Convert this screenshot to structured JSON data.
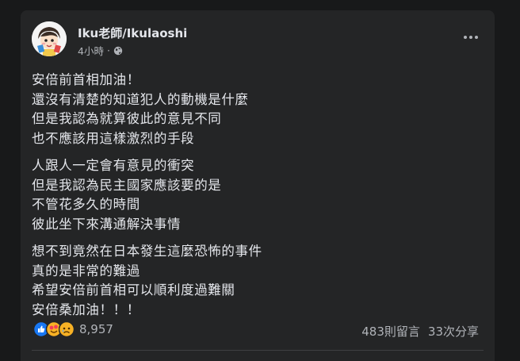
{
  "post": {
    "author": "Iku老師/Ikulaoshi",
    "time": "4小時",
    "separator": "·",
    "paragraphs": [
      [
        "安倍前首相加油！",
        "還沒有清楚的知道犯人的動機是什麼",
        "但是我認為就算彼此的意見不同",
        "也不應該用這樣激烈的手段"
      ],
      [
        "人跟人一定會有意見的衝突",
        "但是我認為民主國家應該要的是",
        "不管花多久的時間",
        "彼此坐下來溝通解決事情"
      ],
      [
        "想不到竟然在日本發生這麼恐怖的事件",
        "真的是非常的難過",
        "希望安倍前首相可以順利度過難關",
        "安倍桑加油！！！"
      ]
    ],
    "reaction_count": "8,957",
    "comments": "483則留言",
    "shares": "33次分享",
    "reaction_types": [
      "like",
      "love",
      "sad"
    ],
    "colors": {
      "like": "#1877f2",
      "love": "#f33e58",
      "sad": "#f7b125"
    }
  }
}
